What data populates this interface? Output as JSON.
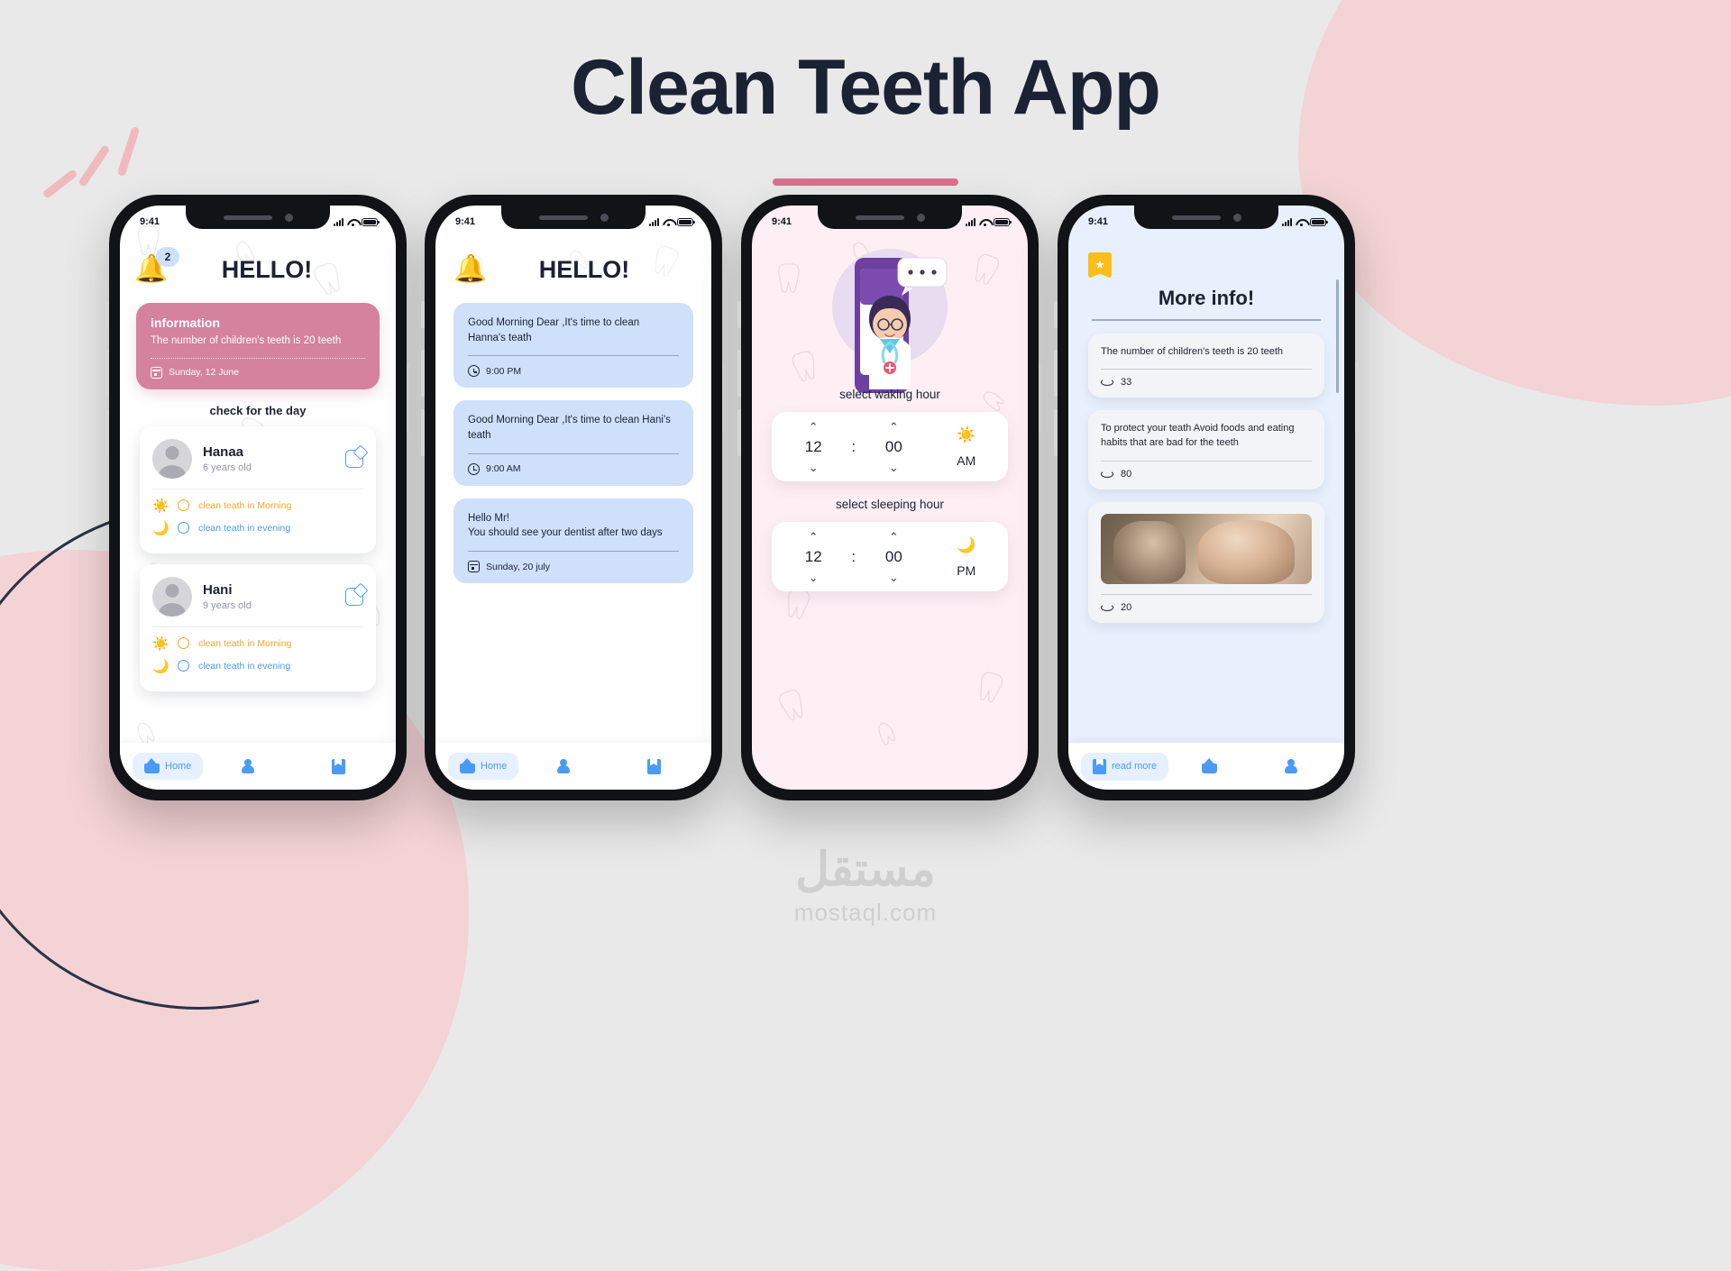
{
  "page": {
    "title": "Clean Teeth App",
    "watermark_ar": "مستقل",
    "watermark_en": "mostaql.com"
  },
  "status_bar": {
    "time": "9:41"
  },
  "screen1": {
    "notification_badge": "2",
    "greeting": "HELLO!",
    "bell_icon": "bell-icon",
    "info_card": {
      "heading": "information",
      "body": "The number of children's teeth is 20 teeth",
      "date": "Sunday, 12 June",
      "color": "#d4829e"
    },
    "section_title": "check for the day",
    "kids": [
      {
        "name": "Hanaa",
        "age": "6 years old",
        "tasks": [
          {
            "label": "clean teath in Morning",
            "icon": "sun-icon",
            "color": "#f5a623",
            "checked": false
          },
          {
            "label": "clean teath in evening",
            "icon": "moon-icon",
            "color": "#4a9bf5",
            "checked": false
          }
        ]
      },
      {
        "name": "Hani",
        "age": "9 years old",
        "tasks": [
          {
            "label": "clean teath in Morning",
            "icon": "sun-icon",
            "color": "#f5a623",
            "checked": false
          },
          {
            "label": "clean teath in evening",
            "icon": "moon-icon",
            "color": "#4a9bf5",
            "checked": false
          }
        ]
      }
    ],
    "nav": [
      {
        "label": "Home",
        "icon": "home-icon",
        "active": true
      },
      {
        "label": "",
        "icon": "user-icon",
        "active": false
      },
      {
        "label": "",
        "icon": "book-icon",
        "active": false
      }
    ]
  },
  "screen2": {
    "greeting": "HELLO!",
    "messages": [
      {
        "text": "Good Morning Dear ,It's time to clean Hanna's teath",
        "meta": "9:00  PM",
        "meta_icon": "clock-icon"
      },
      {
        "text": "Good Morning Dear ,It's time to clean Hani's teath",
        "meta": "9:00  AM",
        "meta_icon": "clock-icon"
      },
      {
        "text": "Hello Mr!\nYou should see your dentist after two days",
        "meta": "Sunday, 20 july",
        "meta_icon": "calendar-icon"
      }
    ],
    "nav": [
      {
        "label": "Home",
        "icon": "home-icon",
        "active": true
      },
      {
        "label": "",
        "icon": "user-icon",
        "active": false
      },
      {
        "label": "",
        "icon": "book-icon",
        "active": false
      }
    ]
  },
  "screen3": {
    "waking_label": "select waking hour",
    "waking_picker": {
      "hour": "12",
      "separator": ":",
      "minute": "00",
      "meridiem": "AM",
      "icon": "sun-icon"
    },
    "sleeping_label": "select sleeping hour",
    "sleeping_picker": {
      "hour": "12",
      "separator": ":",
      "minute": "00",
      "meridiem": "PM",
      "icon": "moon-icon"
    },
    "up_chevron": "⌃",
    "down_chevron": "⌄"
  },
  "screen4": {
    "badge_icon": "bookmark-star-icon",
    "title": "More info!",
    "tiles": [
      {
        "text": "The number of children's teeth is 20 teeth",
        "views": "33",
        "has_photo": false
      },
      {
        "text": "To protect your teath Avoid foods and eating habits that are bad for the teeth",
        "views": "80",
        "has_photo": false
      },
      {
        "text": "",
        "views": "20",
        "has_photo": true
      }
    ],
    "nav": [
      {
        "label": "read more",
        "icon": "book-icon",
        "active": true
      },
      {
        "label": "",
        "icon": "home-icon",
        "active": false
      },
      {
        "label": "",
        "icon": "user-icon",
        "active": false
      }
    ]
  }
}
